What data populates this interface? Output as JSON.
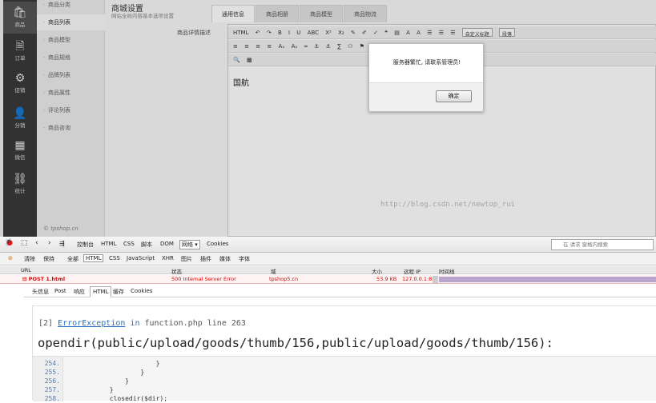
{
  "app": {
    "nav": [
      {
        "label": "商品",
        "icon": "shopping-bag-icon",
        "glyph": "🛍"
      },
      {
        "label": "订单",
        "icon": "order-icon",
        "glyph": "🗎"
      },
      {
        "label": "促销",
        "icon": "gear-icon",
        "glyph": "⚙"
      },
      {
        "label": "分销",
        "icon": "user-icon",
        "glyph": "👤"
      },
      {
        "label": "微信",
        "icon": "database-icon",
        "glyph": "▦"
      },
      {
        "label": "统计",
        "icon": "network-icon",
        "glyph": "⛓"
      }
    ],
    "subnav": [
      "商品分类",
      "商品列表",
      "商品模型",
      "商品规格",
      "品牌列表",
      "商品属性",
      "评论列表",
      "商品咨询"
    ],
    "brand": "© tpshop.cn",
    "page_title": "商城设置",
    "page_subtitle": "网站全局内容基本选项设置",
    "tabs": [
      "通用信息",
      "商品相册",
      "商品模型",
      "商品物流"
    ],
    "field_label": "商品详情描述",
    "editor": {
      "row1": [
        "HTML",
        "↶",
        "↷",
        "B",
        "I",
        "U",
        "ABC",
        "X²",
        "X₂",
        "✎",
        "✐",
        "✓",
        "❝",
        "▤",
        "A",
        "A",
        "☰",
        "☰",
        "☰"
      ],
      "select_font": "自定义标题",
      "select_size": "段落",
      "row2": [
        "≡",
        "≡",
        "≡",
        "≡",
        "Aₓ",
        "Aₓ",
        "═",
        "⚓",
        "⚓",
        "∑",
        "⚇",
        "⚑",
        "☺",
        "▣",
        "Ω",
        "⊞",
        "⊟"
      ],
      "row3": [
        "🔍",
        "▩"
      ],
      "content": "国航"
    },
    "watermark": "http://blog.csdn.net/newtop_rui",
    "dialog": {
      "message": "服务器繁忙, 请联系管理员!",
      "ok_label": "确定"
    }
  },
  "devtools": {
    "toolbar": [
      "控制台",
      "HTML",
      "CSS",
      "脚本",
      "DOM",
      "网络 ▾",
      "Cookies"
    ],
    "search_placeholder": "在 请求 窗格内搜索",
    "filters": [
      "清除",
      "保持",
      "全部",
      "HTML",
      "CSS",
      "JavaScript",
      "XHR",
      "图片",
      "插件",
      "媒体",
      "字体"
    ],
    "columns": [
      "URL",
      "状态",
      "域",
      "大小",
      "远程 IP",
      "时间线"
    ],
    "request": {
      "url": "⊟ POST 1.html",
      "status": "500 Internal Server Error",
      "domain": "tpshop5.cn",
      "size": "53.9 KB",
      "remote_ip": "127.0.0.1:80"
    },
    "detail_tabs": [
      "头信息",
      "Post",
      "响应",
      "HTML",
      "缓存",
      "Cookies"
    ],
    "error": {
      "num": "[2]",
      "cls": "ErrorException",
      "kw": "in",
      "loc": "function.php line 263",
      "message": "opendir(public/upload/goods/thumb/156,public/upload/goods/thumb/156):"
    },
    "code": [
      {
        "ln": "254.",
        "src": "                        }"
      },
      {
        "ln": "255.",
        "src": "                    }"
      },
      {
        "ln": "256.",
        "src": "                }"
      },
      {
        "ln": "257.",
        "src": "            }"
      },
      {
        "ln": "258.",
        "src": "            closedir($dir);"
      }
    ]
  }
}
